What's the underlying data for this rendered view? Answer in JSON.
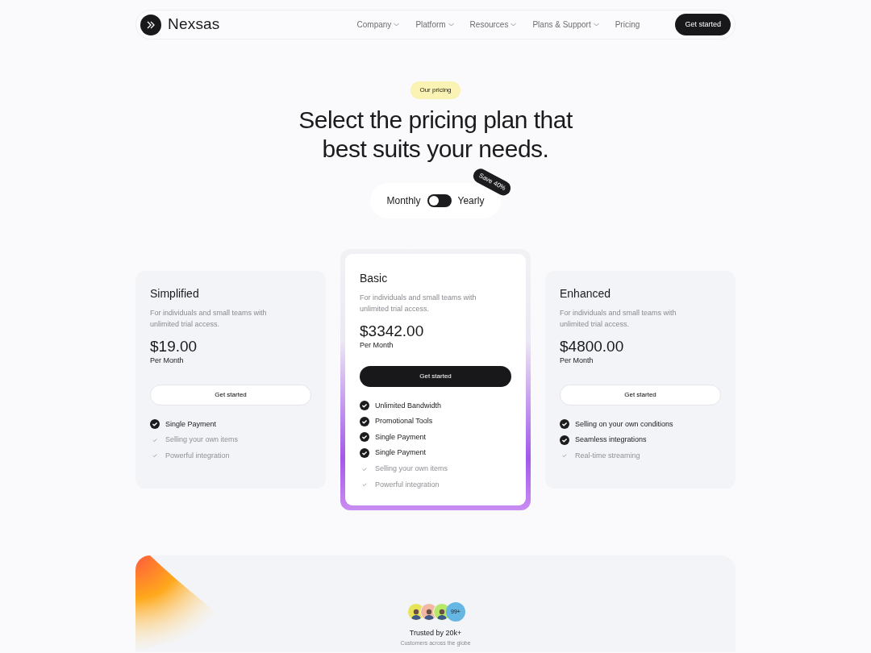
{
  "nav": {
    "brand": "Nexsas",
    "links": [
      {
        "label": "Company",
        "dropdown": true
      },
      {
        "label": "Platform",
        "dropdown": true
      },
      {
        "label": "Resources",
        "dropdown": true
      },
      {
        "label": "Plans & Support",
        "dropdown": true
      },
      {
        "label": "Pricing",
        "dropdown": false
      }
    ],
    "cta": "Get started"
  },
  "hero": {
    "badge": "Our pricing",
    "title_lines": [
      "Select the pricing plan that",
      "best suits your needs."
    ]
  },
  "billing": {
    "left_label": "Monthly",
    "right_label": "Yearly",
    "on": false,
    "save_badge": "Save 40%"
  },
  "plans": [
    {
      "name": "Simplified",
      "description": "For individuals and small teams with unlimited trial access.",
      "price": "$19.00",
      "period": "Per Month",
      "button": "Get started",
      "featured": false,
      "features": [
        {
          "label": "Single Payment",
          "included": true
        },
        {
          "label": "Selling your own items",
          "included": false
        },
        {
          "label": "Powerful integration",
          "included": false
        }
      ]
    },
    {
      "name": "Basic",
      "description": "For individuals and small teams with unlimited trial access.",
      "price": "$3342.00",
      "period": "Per Month",
      "button": "Get started",
      "featured": true,
      "features": [
        {
          "label": "Unlimited Bandwidth",
          "included": true
        },
        {
          "label": "Promotional Tools",
          "included": true
        },
        {
          "label": "Single Payment",
          "included": true
        },
        {
          "label": "Single Payment",
          "included": true
        },
        {
          "label": "Selling your own items",
          "included": false
        },
        {
          "label": "Powerful integration",
          "included": false
        }
      ]
    },
    {
      "name": "Enhanced",
      "description": "For individuals and small teams with unlimited trial access.",
      "price": "$4800.00",
      "period": "Per Month",
      "button": "Get started",
      "featured": false,
      "features": [
        {
          "label": "Selling on your own conditions",
          "included": true
        },
        {
          "label": "Seamless integrations",
          "included": true
        },
        {
          "label": "Real-time streaming",
          "included": false
        }
      ]
    }
  ],
  "trust": {
    "avatars": [
      {
        "color": "#e8e45a"
      },
      {
        "color": "#f2b8a4"
      },
      {
        "color": "#b8e86a"
      }
    ],
    "count_badge": "99+",
    "title": "Trusted by 20k+",
    "subtitle": "Customers across the globe"
  }
}
